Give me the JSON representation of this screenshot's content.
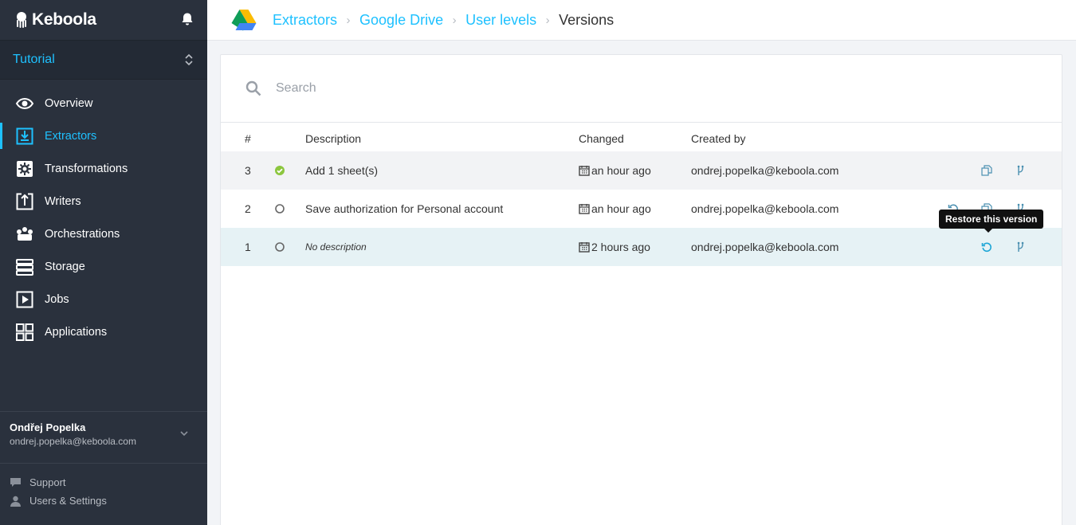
{
  "brand": {
    "name": "Keboola"
  },
  "project": {
    "name": "Tutorial"
  },
  "nav": [
    {
      "label": "Overview",
      "icon": "eye-icon"
    },
    {
      "label": "Extractors",
      "icon": "extractor-icon",
      "active": true
    },
    {
      "label": "Transformations",
      "icon": "gear-icon"
    },
    {
      "label": "Writers",
      "icon": "writer-icon"
    },
    {
      "label": "Orchestrations",
      "icon": "orchestration-icon"
    },
    {
      "label": "Storage",
      "icon": "storage-icon"
    },
    {
      "label": "Jobs",
      "icon": "play-icon"
    },
    {
      "label": "Applications",
      "icon": "grid-icon"
    }
  ],
  "user": {
    "name": "Ondřej Popelka",
    "email": "ondrej.popelka@keboola.com"
  },
  "bottom_links": {
    "support": "Support",
    "settings": "Users & Settings"
  },
  "breadcrumb": [
    "Extractors",
    "Google Drive",
    "User levels",
    "Versions"
  ],
  "search": {
    "placeholder": "Search",
    "value": ""
  },
  "table": {
    "headers": {
      "num": "#",
      "description": "Description",
      "changed": "Changed",
      "created_by": "Created by"
    },
    "rows": [
      {
        "num": "3",
        "status": "active",
        "description": "Add 1 sheet(s)",
        "changed": "an hour ago",
        "created_by": "ondrej.popelka@keboola.com"
      },
      {
        "num": "2",
        "status": "inactive",
        "description": "Save authorization for Personal account",
        "changed": "an hour ago",
        "created_by": "ondrej.popelka@keboola.com"
      },
      {
        "num": "1",
        "status": "inactive",
        "description": "No description",
        "changed": "2 hours ago",
        "created_by": "ondrej.popelka@keboola.com"
      }
    ]
  },
  "tooltip": {
    "text": "Restore this version"
  },
  "colors": {
    "accent": "#1ec1ff",
    "sidebar": "#2a313d",
    "success": "#8cc63e"
  }
}
